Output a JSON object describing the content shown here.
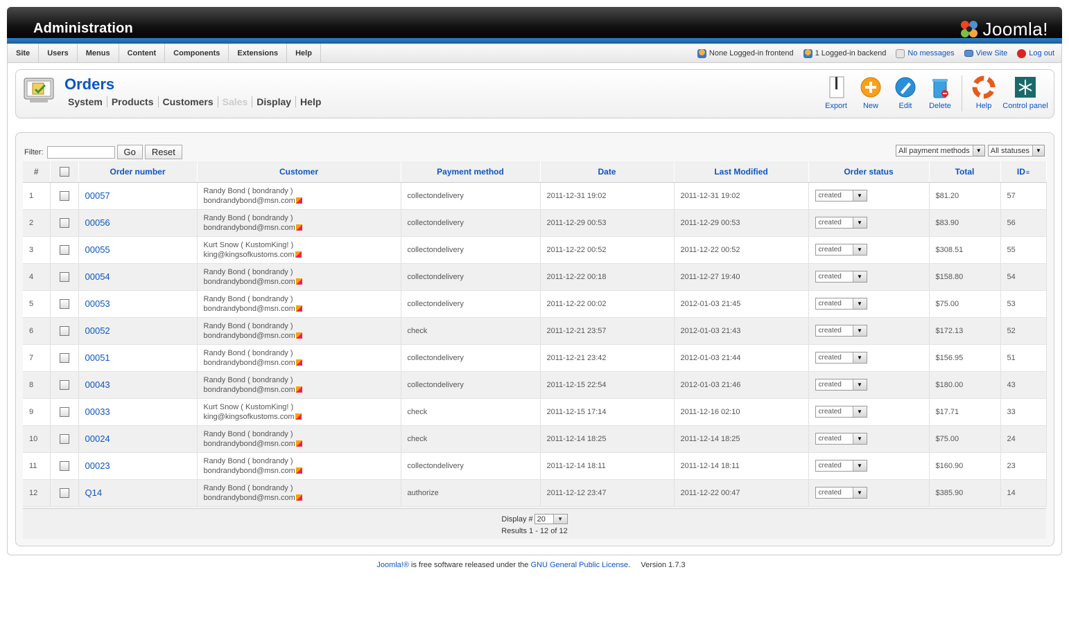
{
  "header": {
    "title": "Administration",
    "logo_text": "Joomla!"
  },
  "menu": [
    "Site",
    "Users",
    "Menus",
    "Content",
    "Components",
    "Extensions",
    "Help"
  ],
  "status": {
    "frontend": "None Logged-in frontend",
    "backend": "1 Logged-in backend",
    "messages": "No messages",
    "view_site": "View Site",
    "logout": "Log out"
  },
  "page": {
    "title": "Orders"
  },
  "submenu": [
    "System",
    "Products",
    "Customers",
    "Sales",
    "Display",
    "Help"
  ],
  "toolbar": [
    "Export",
    "New",
    "Edit",
    "Delete",
    "Help",
    "Control panel"
  ],
  "filter": {
    "label": "Filter:",
    "value": "",
    "go": "Go",
    "reset": "Reset"
  },
  "selects": {
    "payment": "All payment methods",
    "status": "All statuses"
  },
  "columns": [
    "#",
    "",
    "Order number",
    "Customer",
    "Payment method",
    "Date",
    "Last Modified",
    "Order status",
    "Total",
    "ID"
  ],
  "rows": [
    {
      "n": "1",
      "order": "00057",
      "name": "Randy Bond ( bondrandy )",
      "email": "bondrandybond@msn.com",
      "payment": "collectondelivery",
      "date": "2011-12-31 19:02",
      "modified": "2011-12-31 19:02",
      "status": "created",
      "total": "$81.20",
      "id": "57"
    },
    {
      "n": "2",
      "order": "00056",
      "name": "Randy Bond ( bondrandy )",
      "email": "bondrandybond@msn.com",
      "payment": "collectondelivery",
      "date": "2011-12-29 00:53",
      "modified": "2011-12-29 00:53",
      "status": "created",
      "total": "$83.90",
      "id": "56"
    },
    {
      "n": "3",
      "order": "00055",
      "name": "Kurt Snow ( KustomKing! )",
      "email": "king@kingsofkustoms.com",
      "payment": "collectondelivery",
      "date": "2011-12-22 00:52",
      "modified": "2011-12-22 00:52",
      "status": "created",
      "total": "$308.51",
      "id": "55"
    },
    {
      "n": "4",
      "order": "00054",
      "name": "Randy Bond ( bondrandy )",
      "email": "bondrandybond@msn.com",
      "payment": "collectondelivery",
      "date": "2011-12-22 00:18",
      "modified": "2011-12-27 19:40",
      "status": "created",
      "total": "$158.80",
      "id": "54"
    },
    {
      "n": "5",
      "order": "00053",
      "name": "Randy Bond ( bondrandy )",
      "email": "bondrandybond@msn.com",
      "payment": "collectondelivery",
      "date": "2011-12-22 00:02",
      "modified": "2012-01-03 21:45",
      "status": "created",
      "total": "$75.00",
      "id": "53"
    },
    {
      "n": "6",
      "order": "00052",
      "name": "Randy Bond ( bondrandy )",
      "email": "bondrandybond@msn.com",
      "payment": "check",
      "date": "2011-12-21 23:57",
      "modified": "2012-01-03 21:43",
      "status": "created",
      "total": "$172.13",
      "id": "52"
    },
    {
      "n": "7",
      "order": "00051",
      "name": "Randy Bond ( bondrandy )",
      "email": "bondrandybond@msn.com",
      "payment": "collectondelivery",
      "date": "2011-12-21 23:42",
      "modified": "2012-01-03 21:44",
      "status": "created",
      "total": "$156.95",
      "id": "51"
    },
    {
      "n": "8",
      "order": "00043",
      "name": "Randy Bond ( bondrandy )",
      "email": "bondrandybond@msn.com",
      "payment": "collectondelivery",
      "date": "2011-12-15 22:54",
      "modified": "2012-01-03 21:46",
      "status": "created",
      "total": "$180.00",
      "id": "43"
    },
    {
      "n": "9",
      "order": "00033",
      "name": "Kurt Snow ( KustomKing! )",
      "email": "king@kingsofkustoms.com",
      "payment": "check",
      "date": "2011-12-15 17:14",
      "modified": "2011-12-16 02:10",
      "status": "created",
      "total": "$17.71",
      "id": "33"
    },
    {
      "n": "10",
      "order": "00024",
      "name": "Randy Bond ( bondrandy )",
      "email": "bondrandybond@msn.com",
      "payment": "check",
      "date": "2011-12-14 18:25",
      "modified": "2011-12-14 18:25",
      "status": "created",
      "total": "$75.00",
      "id": "24"
    },
    {
      "n": "11",
      "order": "00023",
      "name": "Randy Bond ( bondrandy )",
      "email": "bondrandybond@msn.com",
      "payment": "collectondelivery",
      "date": "2011-12-14 18:11",
      "modified": "2011-12-14 18:11",
      "status": "created",
      "total": "$160.90",
      "id": "23"
    },
    {
      "n": "12",
      "order": "Q14",
      "name": "Randy Bond ( bondrandy )",
      "email": "bondrandybond@msn.com",
      "payment": "authorize",
      "date": "2011-12-12 23:47",
      "modified": "2011-12-22 00:47",
      "status": "created",
      "total": "$385.90",
      "id": "14"
    }
  ],
  "pagination": {
    "display_label": "Display #",
    "display_value": "20",
    "results": "Results 1 - 12 of 12"
  },
  "footer": {
    "joomla": "Joomla!®",
    "text": " is free software released under the ",
    "license": "GNU General Public License",
    "version": ".     Version 1.7.3"
  },
  "colors": {
    "link": "#0b55c4",
    "header_blue": "#1a5da2"
  }
}
